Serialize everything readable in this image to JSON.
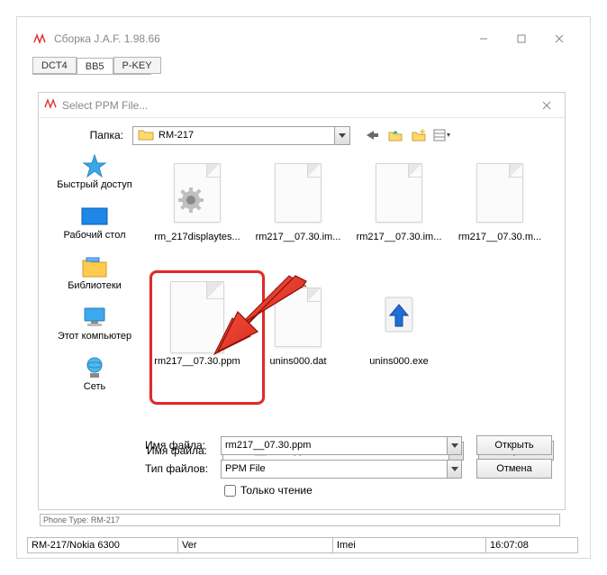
{
  "main_window": {
    "title": "Сборка J.A.F. 1.98.66"
  },
  "tabs": [
    {
      "label": "DCT4",
      "active": false
    },
    {
      "label": "BB5",
      "active": true
    },
    {
      "label": "P-KEY",
      "active": false
    }
  ],
  "dialog": {
    "title": "Select PPM File...",
    "folder_label": "Папка:",
    "folder_value": "RM-217",
    "toolbar_icons": [
      "back-icon",
      "up-one-level-icon",
      "new-folder-icon",
      "views-icon"
    ],
    "places": [
      {
        "label": "Быстрый доступ",
        "icon": "quick-access-icon"
      },
      {
        "label": "Рабочий стол",
        "icon": "desktop-icon"
      },
      {
        "label": "Библиотеки",
        "icon": "libraries-icon"
      },
      {
        "label": "Этот компьютер",
        "icon": "this-pc-icon"
      },
      {
        "label": "Сеть",
        "icon": "network-icon"
      }
    ],
    "files": [
      {
        "label": "rm_217displaytes...",
        "icon": "gear"
      },
      {
        "label": "rm217__07.30.im...",
        "icon": "sheet"
      },
      {
        "label": "rm217__07.30.im...",
        "icon": "sheet"
      },
      {
        "label": "rm217__07.30.m...",
        "icon": "sheet"
      },
      {
        "label": "rm217__07.30.ppm",
        "icon": "sheet",
        "selected": true
      },
      {
        "label": "unins000.dat",
        "icon": "sheet"
      },
      {
        "label": "unins000.exe",
        "icon": "installer"
      }
    ],
    "filename_label": "Имя файла:",
    "filename_value": "rm217__07.30.ppm",
    "filetype_label": "Тип файлов:",
    "filetype_value": "PPM File",
    "readonly_label": "Только чтение",
    "open_btn": "Открыть",
    "cancel_btn": "Отмена"
  },
  "phone_row": "Phone Type: RM-217",
  "statusbar": {
    "model": "RM-217/Nokia 6300",
    "ver": "Ver",
    "imei": "Imei",
    "time": "16:07:08"
  }
}
